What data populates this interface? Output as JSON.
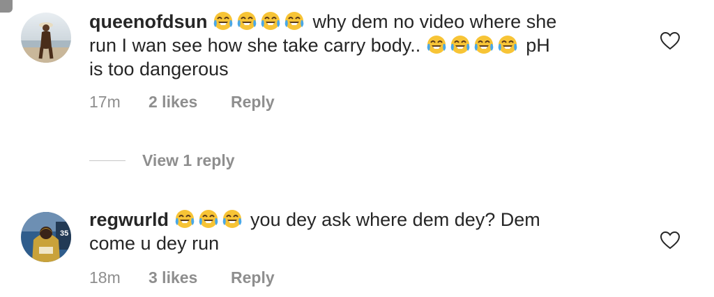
{
  "comments": [
    {
      "username": "queenofdsun",
      "emoji_name": "face-with-tears-of-joy-icon",
      "line1": "why dem no video where she",
      "line2": "run I wan see how she take carry body..",
      "line2_tail": "pH",
      "line3": "is too dangerous",
      "time": "17m",
      "likes": "2 likes",
      "reply": "Reply"
    },
    {
      "username": "regwurld",
      "emoji_name": "face-with-tears-of-joy-icon",
      "line1": "you dey ask where dem dey? Dem",
      "line2": "come u dey run",
      "time": "18m",
      "likes": "3 likes",
      "reply": "Reply"
    }
  ],
  "view_replies": "View 1 reply",
  "colors": {
    "text": "#262626",
    "secondary": "#8e8e8e",
    "emoji_face": "#f7c436",
    "tears": "#4aa8e8"
  },
  "icons": {
    "like": "heart-outline-icon"
  }
}
